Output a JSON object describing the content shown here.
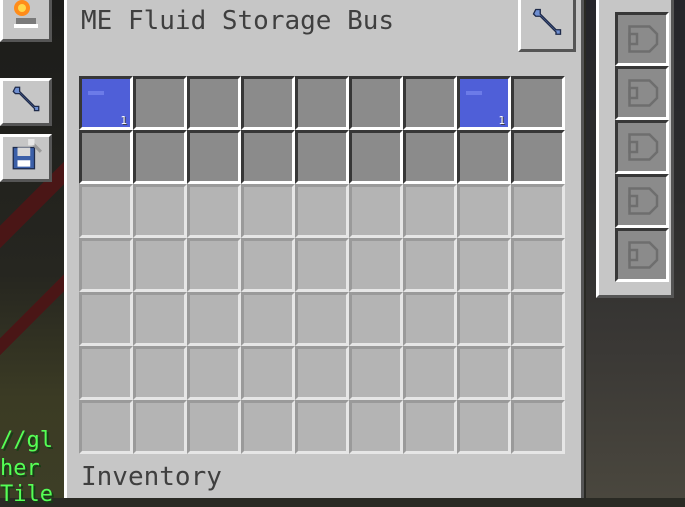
{
  "window": {
    "title": "ME Fluid Storage Bus",
    "inventory_label": "Inventory"
  },
  "config_slots": [
    {
      "filled": true,
      "count": "1"
    },
    {
      "filled": false,
      "count": ""
    },
    {
      "filled": false,
      "count": ""
    },
    {
      "filled": false,
      "count": ""
    },
    {
      "filled": false,
      "count": ""
    },
    {
      "filled": false,
      "count": ""
    },
    {
      "filled": false,
      "count": ""
    },
    {
      "filled": true,
      "count": "1"
    },
    {
      "filled": false,
      "count": ""
    },
    {
      "filled": false,
      "count": ""
    },
    {
      "filled": false,
      "count": ""
    },
    {
      "filled": false,
      "count": ""
    },
    {
      "filled": false,
      "count": ""
    },
    {
      "filled": false,
      "count": ""
    },
    {
      "filled": false,
      "count": ""
    },
    {
      "filled": false,
      "count": ""
    },
    {
      "filled": false,
      "count": ""
    },
    {
      "filled": false,
      "count": ""
    }
  ],
  "storage_rows": 5,
  "storage_cols": 9,
  "upgrade_slot_count": 5,
  "side_buttons": [
    {
      "icon": "redstone-icon"
    },
    {
      "icon": "wrench-icon"
    },
    {
      "icon": "save-config-icon"
    }
  ],
  "world_text": {
    "line1": "//gl",
    "line2": "her",
    "line3": "Tile"
  },
  "colors": {
    "panel": "#c6c6c6",
    "fluid": "#4f5fd8",
    "slot": "#8b8b8b"
  }
}
